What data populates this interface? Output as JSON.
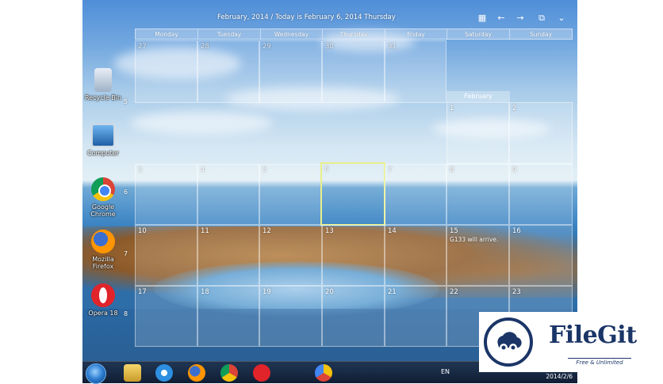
{
  "calendar": {
    "title": "February, 2014 / Today is February 6, 2014 Thursday",
    "weekdays": [
      "Monday",
      "Tuesday",
      "Wednesday",
      "Thursday",
      "Friday",
      "Saturday",
      "Sunday"
    ],
    "week_numbers": [
      "5",
      "6",
      "7",
      "8"
    ],
    "month_label": "February",
    "rows": [
      [
        "27",
        "28",
        "29",
        "30",
        "31",
        "1",
        "2"
      ],
      [
        "3",
        "4",
        "5",
        "6",
        "7",
        "8",
        "9"
      ],
      [
        "10",
        "11",
        "12",
        "13",
        "14",
        "15",
        "16"
      ],
      [
        "17",
        "18",
        "19",
        "20",
        "21",
        "22",
        "23"
      ]
    ],
    "events": {
      "valentines": "",
      "g133": "G133 will arrive."
    },
    "today": "6"
  },
  "desktop_icons": [
    "Recycle Bin",
    "Computer",
    "Google Chrome",
    "Mozilla Firefox",
    "Opera 18"
  ],
  "taskbar": {
    "lang": "EN",
    "clock": "2014/2/6"
  },
  "watermark": {
    "name": "FileGit",
    "tagline": "Free & Unlimited"
  }
}
